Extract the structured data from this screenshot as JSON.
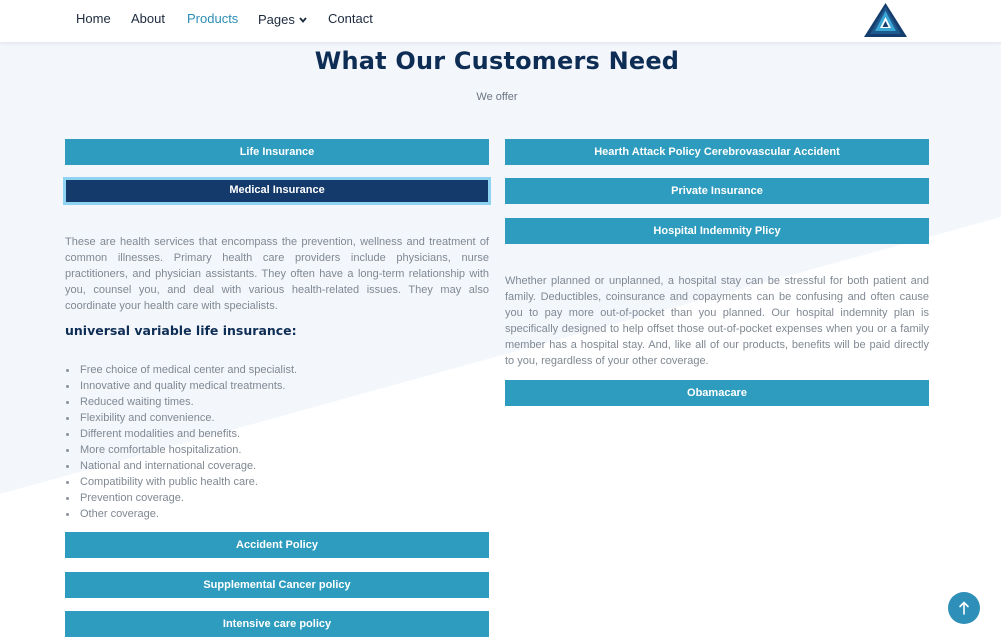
{
  "nav": {
    "items": [
      {
        "label": "Home"
      },
      {
        "label": "About"
      },
      {
        "label": "Products"
      },
      {
        "label": "Pages"
      },
      {
        "label": "Contact"
      }
    ],
    "active": "Products",
    "logo_icon": "triangle-logo-icon"
  },
  "header": {
    "title": "What Our Customers Need",
    "subtitle": "We offer"
  },
  "left": {
    "buttons": [
      "Life Insurance",
      "Medical Insurance"
    ],
    "active_button": "Medical Insurance",
    "description": "These are health services that encompass the prevention, wellness and treatment of common illnesses. Primary health care providers include physicians, nurse practitioners, and physician assistants. They often have a long-term relationship with you, counsel you, and deal with various health-related issues. They may also coordinate your health care with specialists.",
    "subheading": "universal variable life insurance:",
    "features": [
      "Free choice of medical center and specialist.",
      "Innovative and quality medical treatments.",
      "Reduced waiting times.",
      "Flexibility and convenience.",
      "Different modalities and benefits.",
      "More comfortable hospitalization.",
      "National and international coverage.",
      "Compatibility with public health care.",
      "Prevention coverage.",
      "Other coverage."
    ],
    "bottom_buttons": [
      "Accident Policy",
      "Supplemental Cancer policy",
      "Intensive care policy"
    ]
  },
  "right": {
    "buttons": [
      "Hearth Attack Policy Cerebrovascular Accident",
      "Private Insurance",
      "Hospital Indemnity Plicy"
    ],
    "description": "Whether planned or unplanned, a hospital stay can be stressful for both patient and family. Deductibles, coinsurance and copayments can be confusing and often cause you to pay more out-of-pocket than you planned. Our hospital indemnity plan is specifically designed to help offset those out-of-pocket expenses when you or a family member has a hospital stay. And, like all of our products, benefits will be paid directly to you, regardless of your other coverage.",
    "bottom_button": "Obamacare"
  },
  "scroll_top_icon": "arrow-up-icon",
  "colors": {
    "button": "#2e9cbf",
    "button_active": "#143a6b",
    "heading": "#0e2d55",
    "accent": "#2b8db3",
    "background_tint": "#f3f7fc"
  }
}
